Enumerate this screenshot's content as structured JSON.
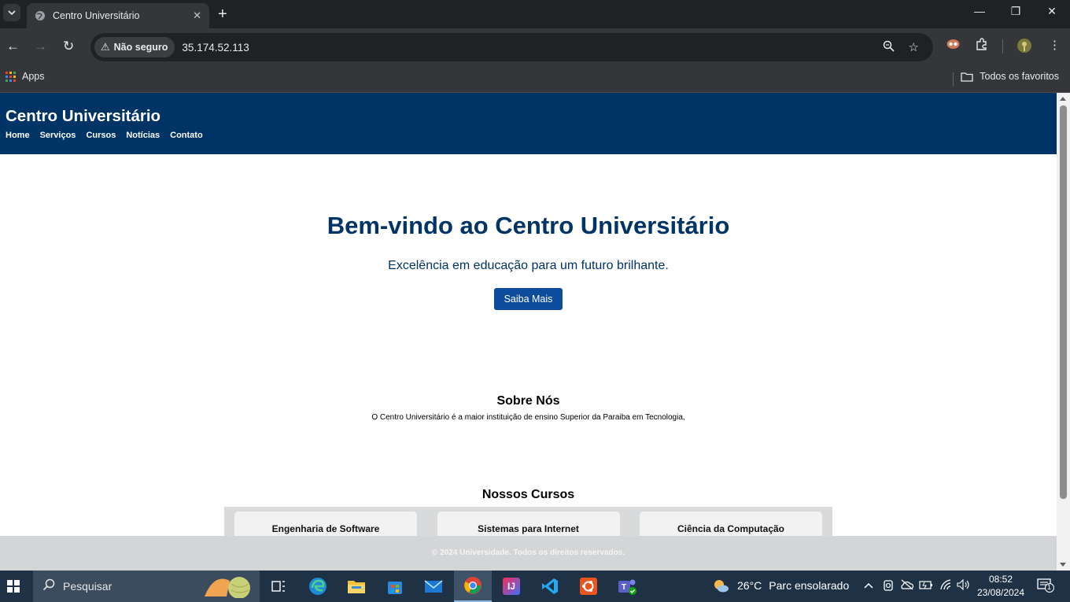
{
  "browser": {
    "tab_title": "Centro Universitário",
    "security_label": "Não seguro",
    "url": "35.174.52.113",
    "bookmarks_apps": "Apps",
    "bookmarks_all": "Todos os favoritos"
  },
  "site": {
    "title": "Centro Universitário",
    "nav": [
      "Home",
      "Serviços",
      "Cursos",
      "Notícias",
      "Contato"
    ],
    "hero": {
      "heading": "Bem-vindo ao Centro Universitário",
      "subtitle": "Excelência em educação para um futuro brilhante.",
      "cta": "Saiba Mais"
    },
    "about": {
      "heading": "Sobre Nós",
      "text": "O Centro Universitário é a maior instituição de ensino Superior da Paraiba em Tecnologia,"
    },
    "courses": {
      "heading": "Nossos Cursos",
      "items": [
        "Engenharia de Software",
        "Sistemas para Internet",
        "Ciência da Computação"
      ]
    },
    "footer": "© 2024 Universidade. Todos os direitos reservados.",
    "colors": {
      "primary": "#003366",
      "button": "#0d4c9c",
      "footer_bg": "#d4d5d7"
    }
  },
  "taskbar": {
    "search_placeholder": "Pesquisar",
    "weather_temp": "26°C",
    "weather_desc": "Parc ensolarado",
    "time": "08:52",
    "date": "23/08/2024",
    "notification_count": "1"
  }
}
